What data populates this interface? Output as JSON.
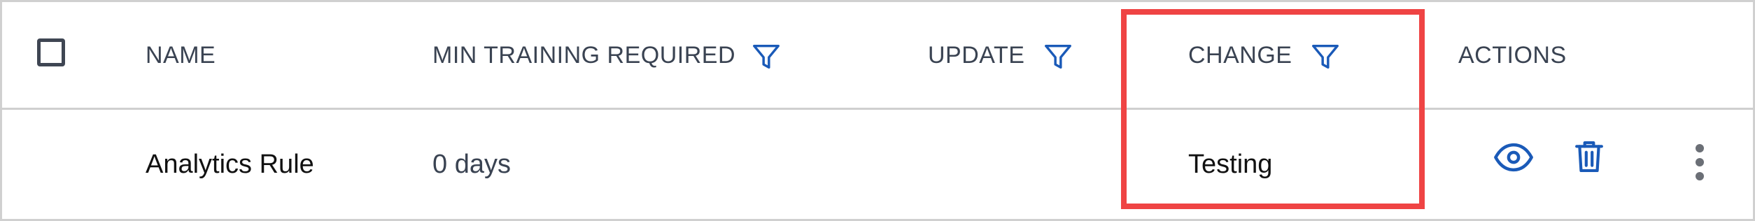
{
  "colors": {
    "accent": "#1a5ab8",
    "header_text": "#3a4352",
    "highlight": "#ef4444",
    "divider": "#cfcfcf"
  },
  "table": {
    "headers": {
      "name": "NAME",
      "min_training": "MIN TRAINING REQUIRED",
      "update": "UPDATE",
      "change": "CHANGE",
      "actions": "ACTIONS"
    },
    "rows": [
      {
        "name": "Analytics Rule",
        "min_training": "0 days",
        "update": "",
        "change": "Testing",
        "actions": [
          "eye-icon",
          "trash-icon",
          "more-vertical-icon"
        ]
      }
    ]
  },
  "icons": {
    "filter": "filter-icon",
    "view": "eye-icon",
    "delete": "trash-icon",
    "more": "more-vertical-icon"
  }
}
